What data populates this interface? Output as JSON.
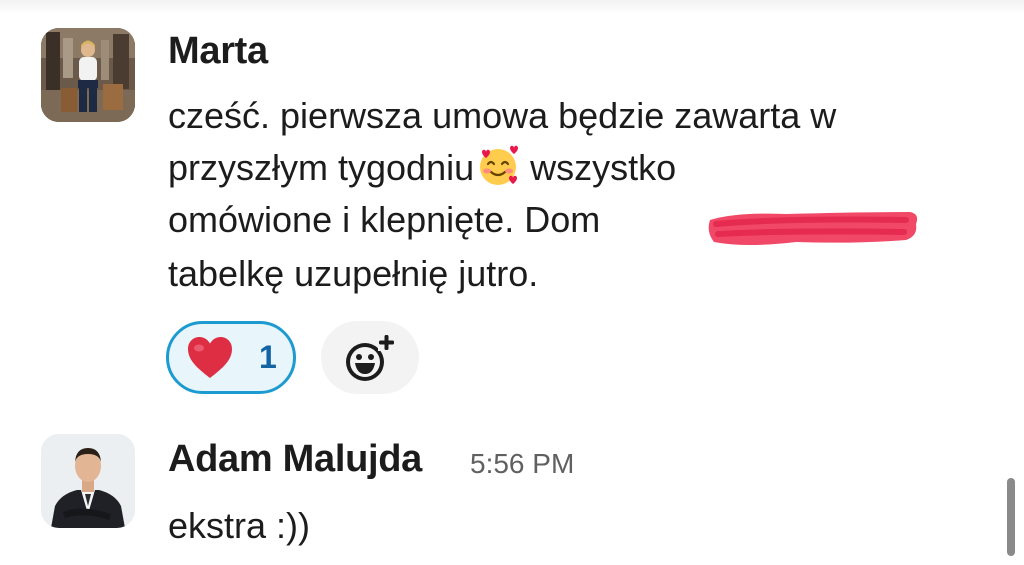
{
  "messages": [
    {
      "author": "Marta",
      "avatar_icon": "marta-avatar",
      "lines": [
        "cześć. pierwsza umowa będzie zawarta w",
        "przyszłym tygodniu",
        " wszystko",
        "omówione i klepnięte. Dom",
        "tabelkę uzupełnię jutro."
      ],
      "inline_emoji": "smiling-face-with-hearts",
      "redaction_color": "#f0385a",
      "reactions": [
        {
          "emoji": "red-heart",
          "count": "1",
          "selected": true
        }
      ],
      "add_reaction_icon": "add-reaction-icon"
    },
    {
      "author": "Adam Malujda",
      "timestamp": "5:56 PM",
      "avatar_icon": "adam-avatar",
      "text": "ekstra :))"
    }
  ],
  "colors": {
    "reaction_border": "#1d9bd1",
    "reaction_bg": "#e8f5fa",
    "reaction_count": "#1264a3",
    "timestamp": "#616061",
    "text": "#1d1c1d"
  }
}
